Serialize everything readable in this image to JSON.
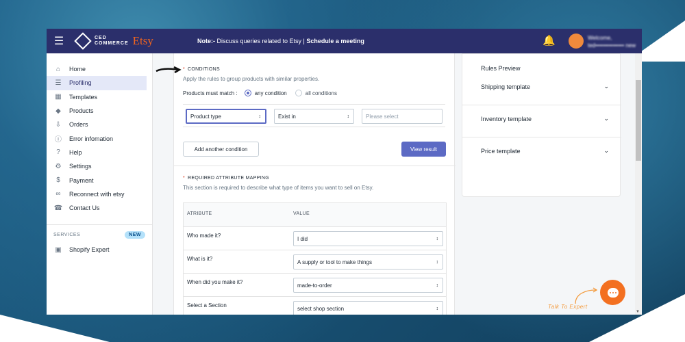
{
  "colors": {
    "topbar": "#2b2f6b",
    "accent": "#5c6ac4",
    "etsy": "#f1641e",
    "chat": "#f37021"
  },
  "topbar": {
    "menu_icon": "hamburger-icon",
    "logo_line1": "CED",
    "logo_line2": "COMMERCE",
    "logo_etsy": "Etsy",
    "note_label": "Note:-",
    "note_text": " Discuss queries related to Etsy | ",
    "note_link": "Schedule a meeting",
    "bell_icon": "bell-icon",
    "welcome": "Welcome,",
    "email": "ted••••••••••••••• new"
  },
  "sidebar": {
    "items": [
      {
        "label": "Home",
        "icon": "home-icon"
      },
      {
        "label": "Profiling",
        "icon": "profiling-icon",
        "active": true
      },
      {
        "label": "Templates",
        "icon": "templates-icon"
      },
      {
        "label": "Products",
        "icon": "tag-icon"
      },
      {
        "label": "Orders",
        "icon": "orders-icon"
      },
      {
        "label": "Error infomation",
        "icon": "info-icon"
      },
      {
        "label": "Help",
        "icon": "help-icon"
      },
      {
        "label": "Settings",
        "icon": "gear-icon"
      },
      {
        "label": "Payment",
        "icon": "dollar-icon"
      },
      {
        "label": "Reconnect with etsy",
        "icon": "link-icon"
      },
      {
        "label": "Contact Us",
        "icon": "phone-icon"
      }
    ],
    "services_label": "SERVICES",
    "new_badge": "NEW",
    "services_item": "Shopify Expert"
  },
  "conditions": {
    "required_mark": "*",
    "title": "CONDITIONS",
    "description": "Apply the rules to group products with similar properties.",
    "match_label": "Products must match :",
    "option_any": "any condition",
    "option_all": "all conditions",
    "field_select": "Product type",
    "operator_select": "Exist in",
    "value_placeholder": "Please select",
    "add_button": "Add another condition",
    "view_button": "View result"
  },
  "mapping": {
    "required_mark": "*",
    "title": "REQUIRED ATTRIBUTE MAPPING",
    "description": "This section is required to describe what type of items you want to sell on Etsy.",
    "col_attr": "ATRIBUTE",
    "col_value": "VALUE",
    "rows": [
      {
        "attribute": "Who made it?",
        "value": "I did"
      },
      {
        "attribute": "What is it?",
        "value": "A supply or tool to make things"
      },
      {
        "attribute": "When did you make it?",
        "value": "made-to-order"
      },
      {
        "attribute": "Select a Section",
        "value": "select shop section"
      }
    ]
  },
  "preview": {
    "title": "Rules Preview",
    "sections": [
      "Shipping template",
      "Inventory template",
      "Price template"
    ]
  },
  "chat": {
    "talk_label": "Talk To Expert"
  }
}
